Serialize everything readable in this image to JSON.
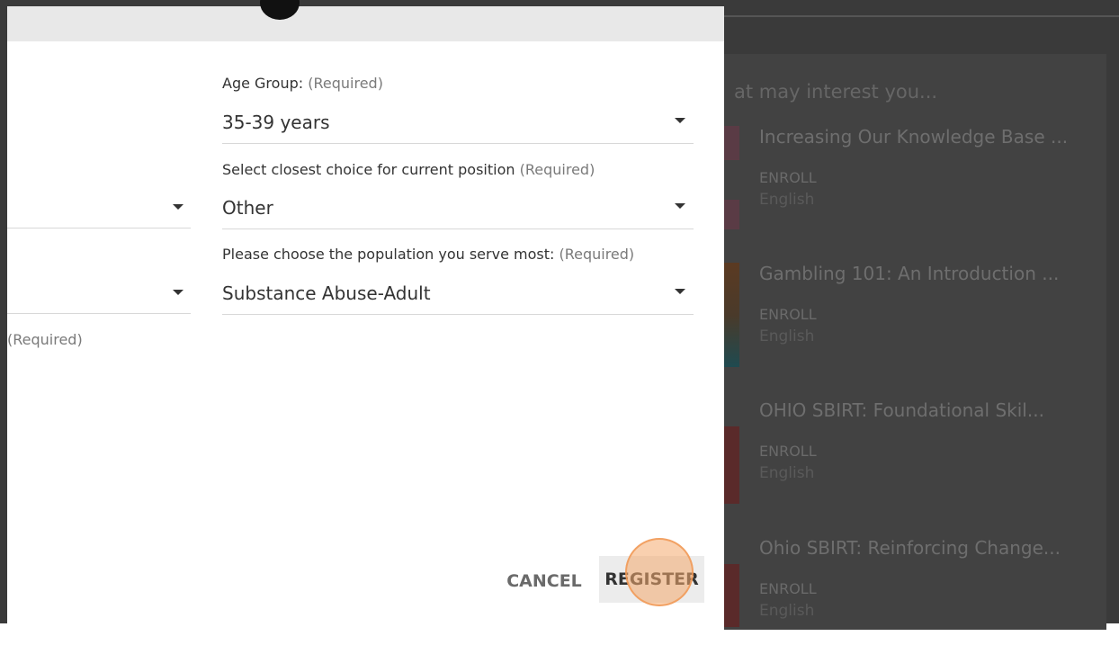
{
  "background": {
    "panel_title": "at may interest you...",
    "courses": [
      {
        "title": "Increasing Our Knowledge Base ...",
        "enroll": "ENROLL",
        "language": "English"
      },
      {
        "title": "Gambling 101: An Introduction ...",
        "enroll": "ENROLL",
        "language": "English"
      },
      {
        "title": "OHIO SBIRT: Foundational Skil...",
        "enroll": "ENROLL",
        "language": "English"
      },
      {
        "title": "Ohio SBIRT: Reinforcing Change...",
        "enroll": "ENROLL",
        "language": "English"
      }
    ]
  },
  "form": {
    "age_group": {
      "label": "Age Group:",
      "required": "(Required)",
      "value": "35-39 years"
    },
    "position": {
      "label": "Select closest choice for current position",
      "required": "(Required)",
      "value": "Other"
    },
    "population": {
      "label": "Please choose the population you serve most:",
      "required": "(Required)",
      "value": "Substance Abuse-Adult"
    },
    "left_required": "(Required)"
  },
  "actions": {
    "cancel": "CANCEL",
    "register": "REGISTER"
  },
  "colors": {
    "accent_click": "#f4aa6e",
    "overlay": "#3a3a3a"
  }
}
